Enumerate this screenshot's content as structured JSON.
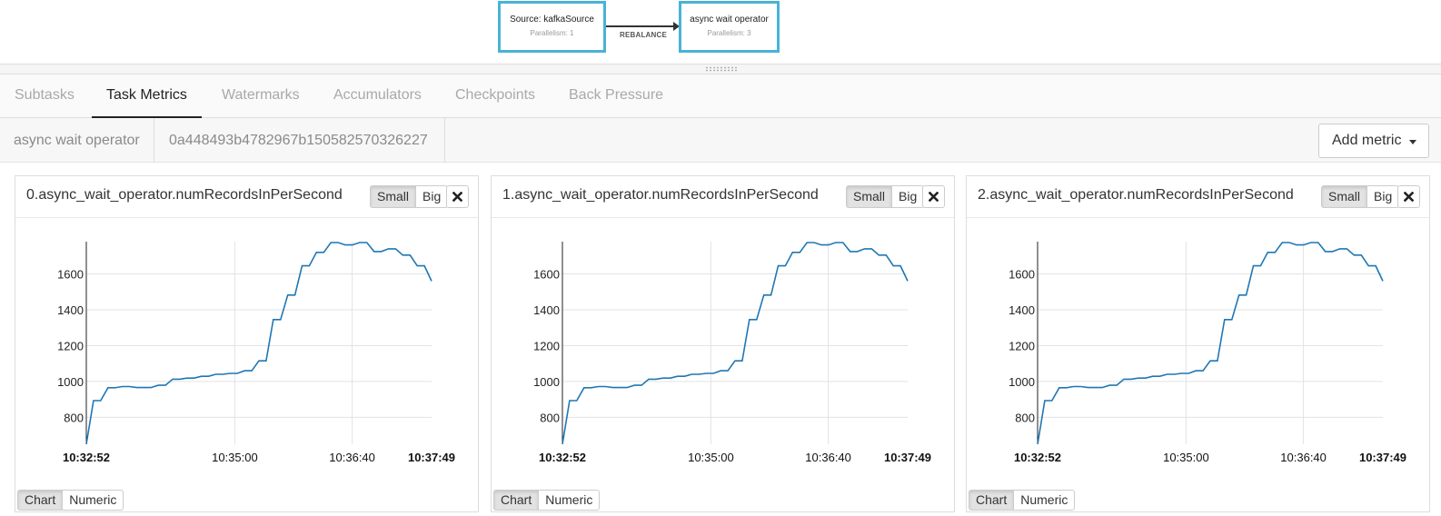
{
  "graph": {
    "source_node": {
      "title": "Source: kafkaSource",
      "parallelism": "Parallelism: 1"
    },
    "target_node": {
      "title": "async wait operator",
      "parallelism": "Parallelism: 3"
    },
    "edge_label": "REBALANCE",
    "node_border_color": "#48b3d6"
  },
  "tabs": [
    {
      "label": "Subtasks",
      "active": false
    },
    {
      "label": "Task Metrics",
      "active": true
    },
    {
      "label": "Watermarks",
      "active": false
    },
    {
      "label": "Accumulators",
      "active": false
    },
    {
      "label": "Checkpoints",
      "active": false
    },
    {
      "label": "Back Pressure",
      "active": false
    }
  ],
  "subheader": {
    "operator_name": "async wait operator",
    "vertex_id": "0a448493b4782967b150582570326227",
    "add_metric_label": "Add metric"
  },
  "panels": [
    {
      "title": "0.async_wait_operator.numRecordsInPerSecond"
    },
    {
      "title": "1.async_wait_operator.numRecordsInPerSecond"
    },
    {
      "title": "2.async_wait_operator.numRecordsInPerSecond"
    }
  ],
  "panel_controls": {
    "small_label": "Small",
    "big_label": "Big",
    "selected_size": "Small",
    "chart_label": "Chart",
    "numeric_label": "Numeric",
    "selected_view": "Chart",
    "close_icon": "close-icon"
  },
  "chart_data": {
    "type": "line",
    "line_color": "#1f77b4",
    "grid": true,
    "ylim": [
      650,
      1780
    ],
    "yticks": [
      800,
      1000,
      1200,
      1400,
      1600
    ],
    "xticks": [
      "10:32:52",
      "10:35:00",
      "10:36:40",
      "10:37:49"
    ],
    "series": [
      {
        "values": [
          650,
          893,
          893,
          965,
          965,
          972,
          972,
          966,
          966,
          966,
          979,
          979,
          1013,
          1013,
          1019,
          1019,
          1029,
          1029,
          1040,
          1040,
          1045,
          1045,
          1060,
          1060,
          1115,
          1115,
          1345,
          1345,
          1482,
          1482,
          1645,
          1645,
          1720,
          1720,
          1775,
          1775,
          1762,
          1762,
          1775,
          1775,
          1725,
          1725,
          1740,
          1740,
          1705,
          1705,
          1645,
          1645,
          1560
        ]
      }
    ]
  }
}
